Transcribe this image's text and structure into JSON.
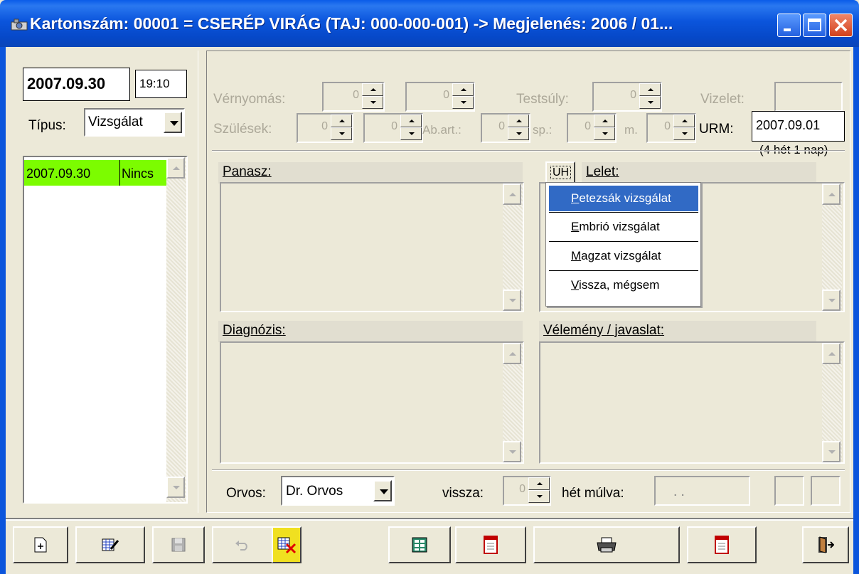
{
  "window": {
    "title": "Kartonszám: 00001 = CSERÉP VIRÁG  (TAJ: 000-000-001)  ->  Megjelenés: 2006 / 01...",
    "colors": {
      "titlebar": "#0b55dc",
      "face": "#ece9d8",
      "list_highlight": "#7cfc00",
      "menu_select": "#316ac5"
    }
  },
  "left": {
    "date": "2007.09.30",
    "time": "19:10",
    "tipus_label": "Típus:",
    "tipus_value": "Vizsgálat",
    "list": [
      {
        "date": "2007.09.30",
        "status": "Nincs"
      }
    ]
  },
  "vitals": {
    "vernyomas_label": "Vérnyomás:",
    "vernyomas_sys": "0",
    "vernyomas_dia": "0",
    "testsuly_label": "Testsúly:",
    "testsuly_value": "0",
    "vizelet_label": "Vizelet:",
    "vizelet_value": "",
    "szulesek_label": "Szülések:",
    "szulesek_1": "0",
    "szulesek_2": "0",
    "abart_label": "Ab.art.:",
    "abart_value": "0",
    "sp_label": "sp.:",
    "sp_value": "0",
    "m_label": "m.",
    "m_value": "0",
    "urm_label": "URM:",
    "urm_value": "2007.09.01",
    "urm_note": "(4 hét 1 nap)"
  },
  "sections": {
    "panasz": "Panasz:",
    "uh_button": "UH",
    "lelet": "Lelet:",
    "diagnozis": "Diagnózis:",
    "velemeny": "Vélemény / javaslat:"
  },
  "popup_menu": [
    {
      "label": "Petezsák vizsgálat",
      "accel": "P",
      "rest": "etezsák vizsgálat",
      "selected": true
    },
    {
      "label": "Embrió vizsgálat",
      "accel": "E",
      "rest": "mbrió vizsgálat",
      "selected": false
    },
    {
      "label": "Magzat vizsgálat",
      "accel": "M",
      "rest": "agzat vizsgálat",
      "selected": false
    },
    {
      "label": "Vissza, mégsem",
      "accel": "V",
      "rest": "issza, mégsem",
      "selected": false
    }
  ],
  "footer": {
    "orvos_label": "Orvos:",
    "orvos_value": "Dr. Orvos",
    "vissza_label": "vissza:",
    "vissza_value": "0",
    "het_mulva_label": "hét múlva:",
    "het_mulva_value": ". ."
  },
  "toolbar": [
    "new-record-icon",
    "edit-record-icon",
    "save-icon",
    "undo-icon",
    "delete-record-icon",
    "table-icon",
    "document-icon",
    "print-icon",
    "document-icon",
    "exit-door-icon"
  ]
}
